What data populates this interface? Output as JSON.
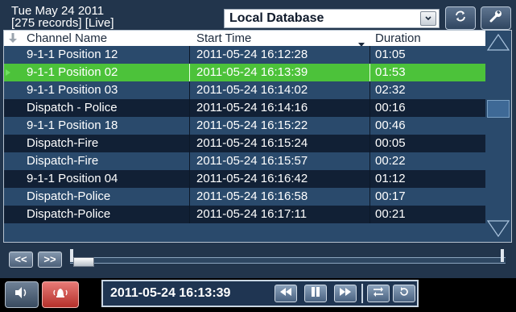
{
  "header": {
    "date": "Tue May 24 2011",
    "records": "[275 records]  [Live]",
    "database_select": "Local Database"
  },
  "table": {
    "columns": [
      "Channel Name",
      "Start Time",
      "Duration"
    ],
    "sort_column": "Start Time",
    "selected_row": 1,
    "rows": [
      {
        "channel": "9-1-1 Position 12",
        "start": "2011-05-24  16:12:28",
        "duration": "01:05"
      },
      {
        "channel": "9-1-1 Position 02",
        "start": "2011-05-24  16:13:39",
        "duration": "01:53"
      },
      {
        "channel": "9-1-1 Position 03",
        "start": "2011-05-24  16:14:02",
        "duration": "02:32"
      },
      {
        "channel": "Dispatch - Police",
        "start": "2011-05-24  16:14:16",
        "duration": "00:16"
      },
      {
        "channel": "9-1-1 Position 18",
        "start": "2011-05-24  16:15:22",
        "duration": "00:46"
      },
      {
        "channel": "Dispatch-Fire",
        "start": "2011-05-24  16:15:24",
        "duration": "00:05"
      },
      {
        "channel": "Dispatch-Fire",
        "start": "2011-05-24  16:15:57",
        "duration": "00:22"
      },
      {
        "channel": "9-1-1 Position 04",
        "start": "2011-05-24  16:16:42",
        "duration": "01:12"
      },
      {
        "channel": "Dispatch-Police",
        "start": "2011-05-24  16:16:58",
        "duration": "00:17"
      },
      {
        "channel": "Dispatch-Police",
        "start": "2011-05-24  16:17:11",
        "duration": "00:21"
      }
    ]
  },
  "navigation": {
    "prev_label": "<<",
    "next_label": ">>"
  },
  "playback": {
    "timestamp": "2011-05-24  16:13:39",
    "position": 0.0
  },
  "colors": {
    "selected_row": "#4cc23a",
    "row_light": "#2a4a6c",
    "row_dark": "#112035",
    "alarm": "#c6403a"
  },
  "icons": {
    "refresh": "refresh-icon",
    "settings": "wrench-icon",
    "volume": "speaker-icon",
    "alarm": "alarm-bell-icon",
    "rewind": "rewind-icon",
    "pause": "pause-icon",
    "forward": "fast-forward-icon",
    "loop": "loop-icon",
    "replay": "replay-icon"
  }
}
